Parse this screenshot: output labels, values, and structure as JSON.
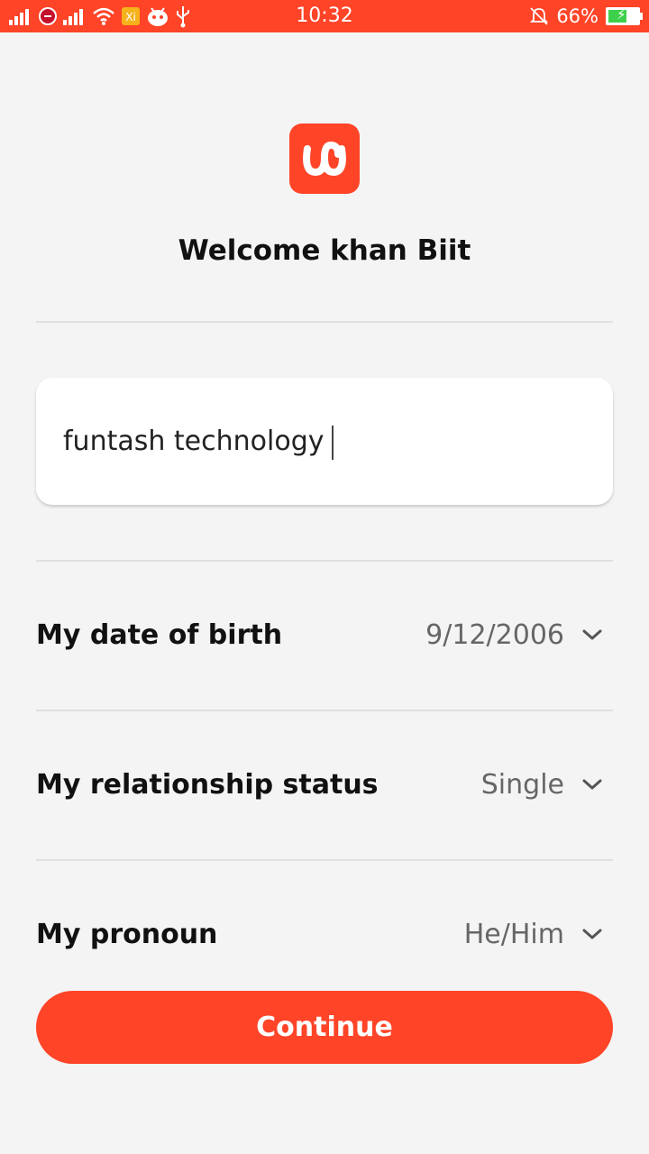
{
  "status_bar": {
    "time": "10:32",
    "battery_percent": "66%",
    "battery_level": 0.66,
    "icons": [
      "signal-icon",
      "notification-badge-icon",
      "signal-icon",
      "wifi-icon",
      "xi-app-icon",
      "android-icon",
      "usb-icon",
      "mute-icon",
      "battery-charging-icon"
    ]
  },
  "colors": {
    "accent": "#ff4428",
    "background": "#f4f4f4"
  },
  "header": {
    "logo_icon": "app-logo-icon",
    "welcome": "Welcome khan Biit"
  },
  "name_input": {
    "value": "funtash technology"
  },
  "fields": {
    "dob": {
      "label": "My date of birth",
      "value": "9/12/2006",
      "icon": "chevron-down-icon"
    },
    "relationship": {
      "label": "My relationship status",
      "value": "Single",
      "icon": "chevron-down-icon"
    },
    "pronoun": {
      "label": "My pronoun",
      "value": "He/Him",
      "icon": "chevron-down-icon"
    }
  },
  "actions": {
    "continue_label": "Continue"
  }
}
